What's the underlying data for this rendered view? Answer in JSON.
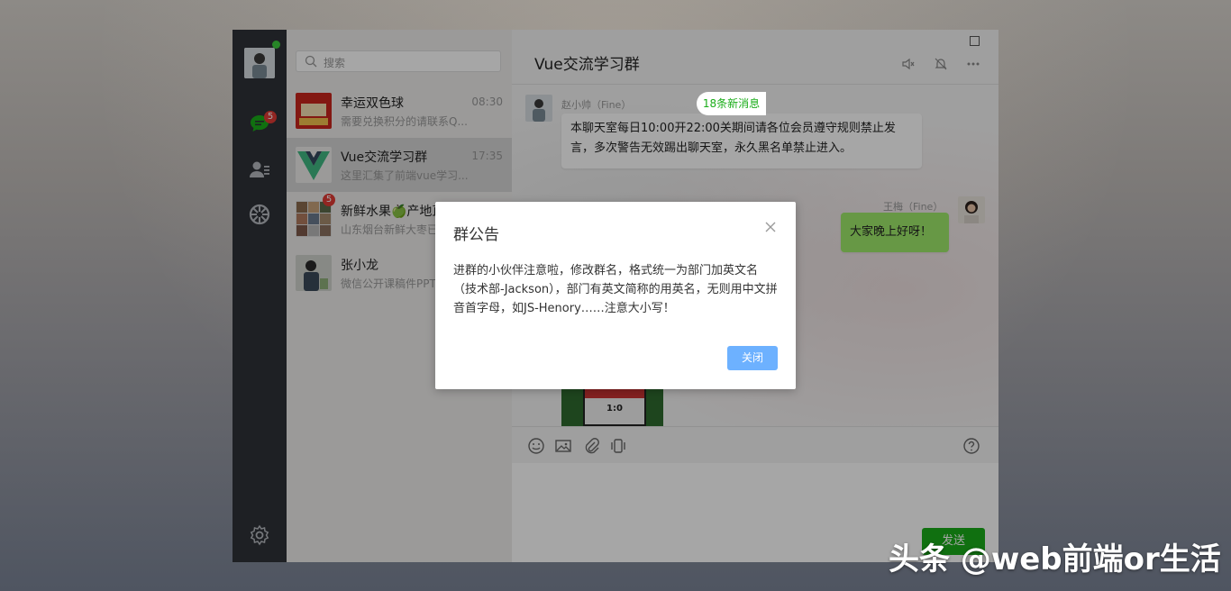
{
  "search": {
    "placeholder": "搜索"
  },
  "nav": {
    "chat_badge": "5"
  },
  "chats": [
    {
      "name": "幸运双色球",
      "time": "08:30",
      "preview": "需要兑换积分的请联系Q..."
    },
    {
      "name": "Vue交流学习群",
      "time": "17:35",
      "preview": "这里汇集了前端vue学习..."
    },
    {
      "name": "新鲜水果🍏产地直",
      "time": "",
      "preview": "山东烟台新鲜大枣已...",
      "badge": "5"
    },
    {
      "name": "张小龙",
      "time": "",
      "preview": "微信公开课稿件PPT..."
    }
  ],
  "chat": {
    "title": "Vue交流学习群",
    "new_messages": "18条新消息",
    "messages": [
      {
        "sender": "赵小帅（Fine）",
        "text": "本聊天室每日10:00开22:00关期间请各位会员遵守规则禁止发言，多次警告无效踢出聊天室，永久黑名单禁止进入。"
      },
      {
        "sender": "王梅（Fine）",
        "text": "大家晚上好呀！"
      }
    ],
    "image_score": "1:0",
    "send_label": "发送"
  },
  "dialog": {
    "title": "群公告",
    "body": "进群的小伙伴注意啦，修改群名，格式统一为部门加英文名（技术部-Jackson），部门有英文简称的用英名，无则用中文拼音首字母，如JS-Henory……注意大小写！",
    "close_label": "关闭"
  },
  "watermark": "头条 @web前端or生活",
  "colors": {
    "nav_bg": "#2e3238",
    "accent_green": "#1aad19",
    "badge_red": "#e03b35",
    "dialog_button": "#6db1ff"
  }
}
